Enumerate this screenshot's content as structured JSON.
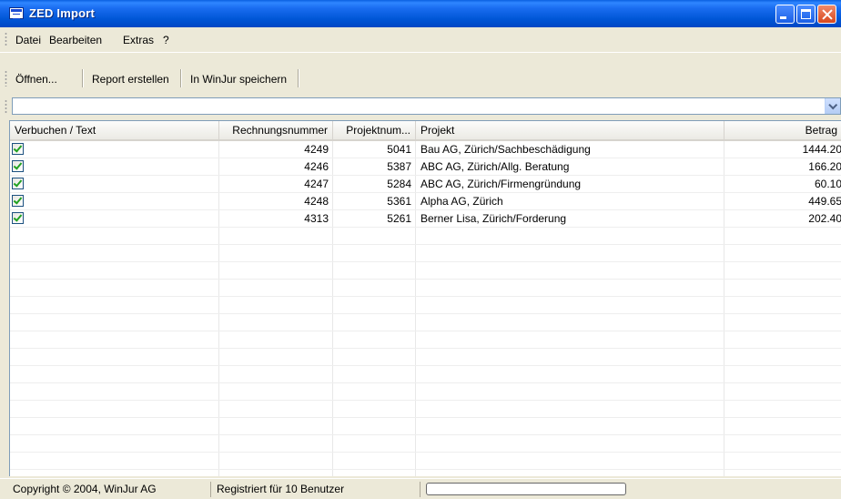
{
  "window": {
    "title": "ZED Import"
  },
  "menu": {
    "items": [
      "Datei",
      "Bearbeiten",
      "Extras",
      "?"
    ]
  },
  "toolbar": {
    "open": "Öffnen...",
    "report": "Report erstellen",
    "save": "In WinJur speichern"
  },
  "combo": {
    "value": ""
  },
  "grid": {
    "columns": [
      "Verbuchen / Text",
      "Rechnungsnummer",
      "Projektnum...",
      "Projekt",
      "Betrag"
    ],
    "rows": [
      {
        "checked": true,
        "invoice": "4249",
        "project_no": "5041",
        "project": "Bau AG, Zürich/Sachbeschädigung",
        "amount": "1444.20"
      },
      {
        "checked": true,
        "invoice": "4246",
        "project_no": "5387",
        "project": "ABC AG, Zürich/Allg. Beratung",
        "amount": "166.20"
      },
      {
        "checked": true,
        "invoice": "4247",
        "project_no": "5284",
        "project": "ABC AG, Zürich/Firmengründung",
        "amount": "60.10"
      },
      {
        "checked": true,
        "invoice": "4248",
        "project_no": "5361",
        "project": "Alpha AG, Zürich",
        "amount": "449.65"
      },
      {
        "checked": true,
        "invoice": "4313",
        "project_no": "5261",
        "project": "Berner Lisa, Zürich/Forderung",
        "amount": "202.40"
      }
    ]
  },
  "status": {
    "copyright": "Copyright © 2004, WinJur AG",
    "license": "Registriert für 10 Benutzer",
    "progress": 0
  }
}
